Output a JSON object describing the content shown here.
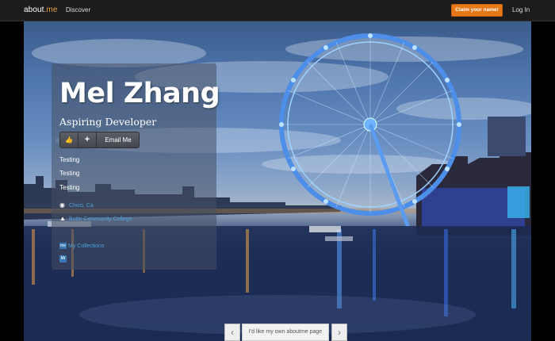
{
  "header": {
    "logo_main": "about",
    "logo_dot": ".me",
    "nav_discover": "Discover",
    "claim_button": "Claim your name!",
    "login": "Log In"
  },
  "profile": {
    "name": "Mel Zhang",
    "headline": "Aspiring Developer",
    "email_button": "Email Me",
    "like_icon": "thumbs-up-icon",
    "add_icon": "plus-icon",
    "bio_lines": [
      "Testing",
      "Testing",
      "Testing"
    ],
    "location": "Chico, Ca",
    "school": "Butte Community College",
    "collections": "My Collections",
    "linkedin_icon": "linkedin-icon"
  },
  "pager": {
    "prev_icon": "chevron-left-icon",
    "next_icon": "chevron-right-icon",
    "label": "I'd like my own aboutme page"
  },
  "colors": {
    "accent": "#e77817",
    "link": "#4aa0d8",
    "topbar": "#1c1c1e"
  }
}
